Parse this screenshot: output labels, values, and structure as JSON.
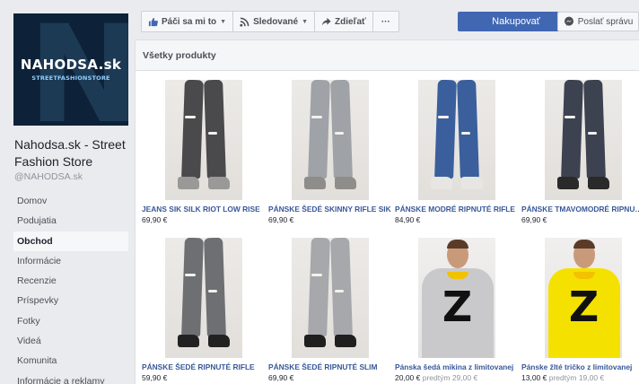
{
  "page": {
    "logo_text": "NAHODSA.sk",
    "logo_subtext": "STREETFASHIONSTORE",
    "name": "Nahodsa.sk - Street Fashion Store",
    "handle": "@NAHODSA.sk"
  },
  "nav": [
    {
      "label": "Domov",
      "active": false
    },
    {
      "label": "Podujatia",
      "active": false
    },
    {
      "label": "Obchod",
      "active": true
    },
    {
      "label": "Informácie",
      "active": false
    },
    {
      "label": "Recenzie",
      "active": false
    },
    {
      "label": "Príspevky",
      "active": false
    },
    {
      "label": "Fotky",
      "active": false
    },
    {
      "label": "Videá",
      "active": false
    },
    {
      "label": "Komunita",
      "active": false
    },
    {
      "label": "Informácie a reklamy",
      "active": false
    }
  ],
  "actions": {
    "like": "Páči sa mi to",
    "follow": "Sledované",
    "share": "Zdieľať",
    "more": "···",
    "shop": "Nakupovať",
    "message": "Poslať správu"
  },
  "shop": {
    "header": "Všetky produkty",
    "products": [
      {
        "title": "JEANS SIK SILK RIOT LOW RISE",
        "price": "69,90 €",
        "old_price": "",
        "image": "dark-grey-ripped-jeans",
        "kind": "jeans",
        "denim": "#4a4a4c",
        "shoes": "#9a9998"
      },
      {
        "title": "PÁNSKE ŠEDÉ SKINNY RIFLE SIK",
        "price": "69,90 €",
        "old_price": "",
        "image": "grey-skinny-jeans",
        "kind": "jeans",
        "denim": "#9fa2a6",
        "shoes": "#8e8d8a"
      },
      {
        "title": "PÁNSKE MODRÉ RIPNUTÉ RIFLE",
        "price": "84,90 €",
        "old_price": "",
        "image": "blue-ripped-jeans",
        "kind": "jeans",
        "denim": "#3a5f9c",
        "shoes": "#e8e6e3"
      },
      {
        "title": "PÁNSKE TMAVOMODRÉ RIPNUTÉ",
        "price": "69,90 €",
        "old_price": "",
        "image": "dark-blue-ripped-jeans",
        "kind": "jeans",
        "denim": "#3c4250",
        "shoes": "#2a2a2a"
      },
      {
        "title": "PÁNSKE ŠEDÉ RIPNUTÉ RIFLE",
        "price": "59,90 €",
        "old_price": "",
        "image": "grey-ripped-biker-jeans",
        "kind": "jeans",
        "denim": "#6e6f72",
        "shoes": "#222222"
      },
      {
        "title": "PÁNSKE ŠEDÉ RIPNUTÉ SLIM",
        "price": "69,90 €",
        "old_price": "",
        "image": "light-grey-slim-jeans",
        "kind": "jeans",
        "denim": "#a6a8ab",
        "shoes": "#1f1f1f"
      },
      {
        "title": "Pánska šedá mikina z limitovanej",
        "price": "20,00 €",
        "old_price": "predtým 29,00 €",
        "image": "grey-sweatshirt-z",
        "kind": "top",
        "top": "#c9c9cb",
        "letter": "Z"
      },
      {
        "title": "Pánske žlté tričko z limitovanej",
        "price": "13,00 €",
        "old_price": "predtým 19,00 €",
        "image": "yellow-tshirt-z",
        "kind": "top",
        "top": "#f5e100",
        "letter": "Z"
      }
    ]
  },
  "colors": {
    "accent": "#4267b2",
    "link": "#385898",
    "background": "#e9ebee"
  }
}
